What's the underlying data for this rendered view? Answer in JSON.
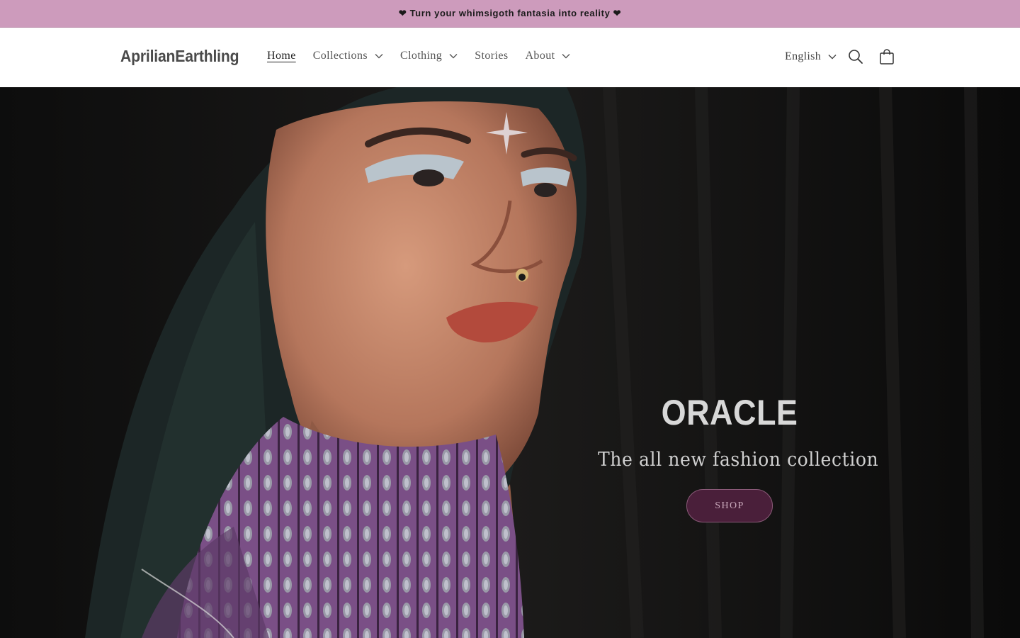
{
  "announcement": {
    "text": "❤ Turn your whimsigoth fantasia into reality ❤"
  },
  "header": {
    "logo": "AprilianEarthling",
    "nav": [
      {
        "label": "Home",
        "active": true,
        "dropdown": false
      },
      {
        "label": "Collections",
        "active": false,
        "dropdown": true
      },
      {
        "label": "Clothing",
        "active": false,
        "dropdown": true
      },
      {
        "label": "Stories",
        "active": false,
        "dropdown": false
      },
      {
        "label": "About",
        "active": false,
        "dropdown": true
      }
    ],
    "language": "English",
    "icons": {
      "search": "search-icon",
      "cart": "cart-icon"
    }
  },
  "hero": {
    "title": "ORACLE",
    "subtitle": "The all new fashion collection",
    "button": "SHOP",
    "colors": {
      "accent": "#4a1f3a",
      "announcement_bg": "#cd9bbc"
    }
  }
}
